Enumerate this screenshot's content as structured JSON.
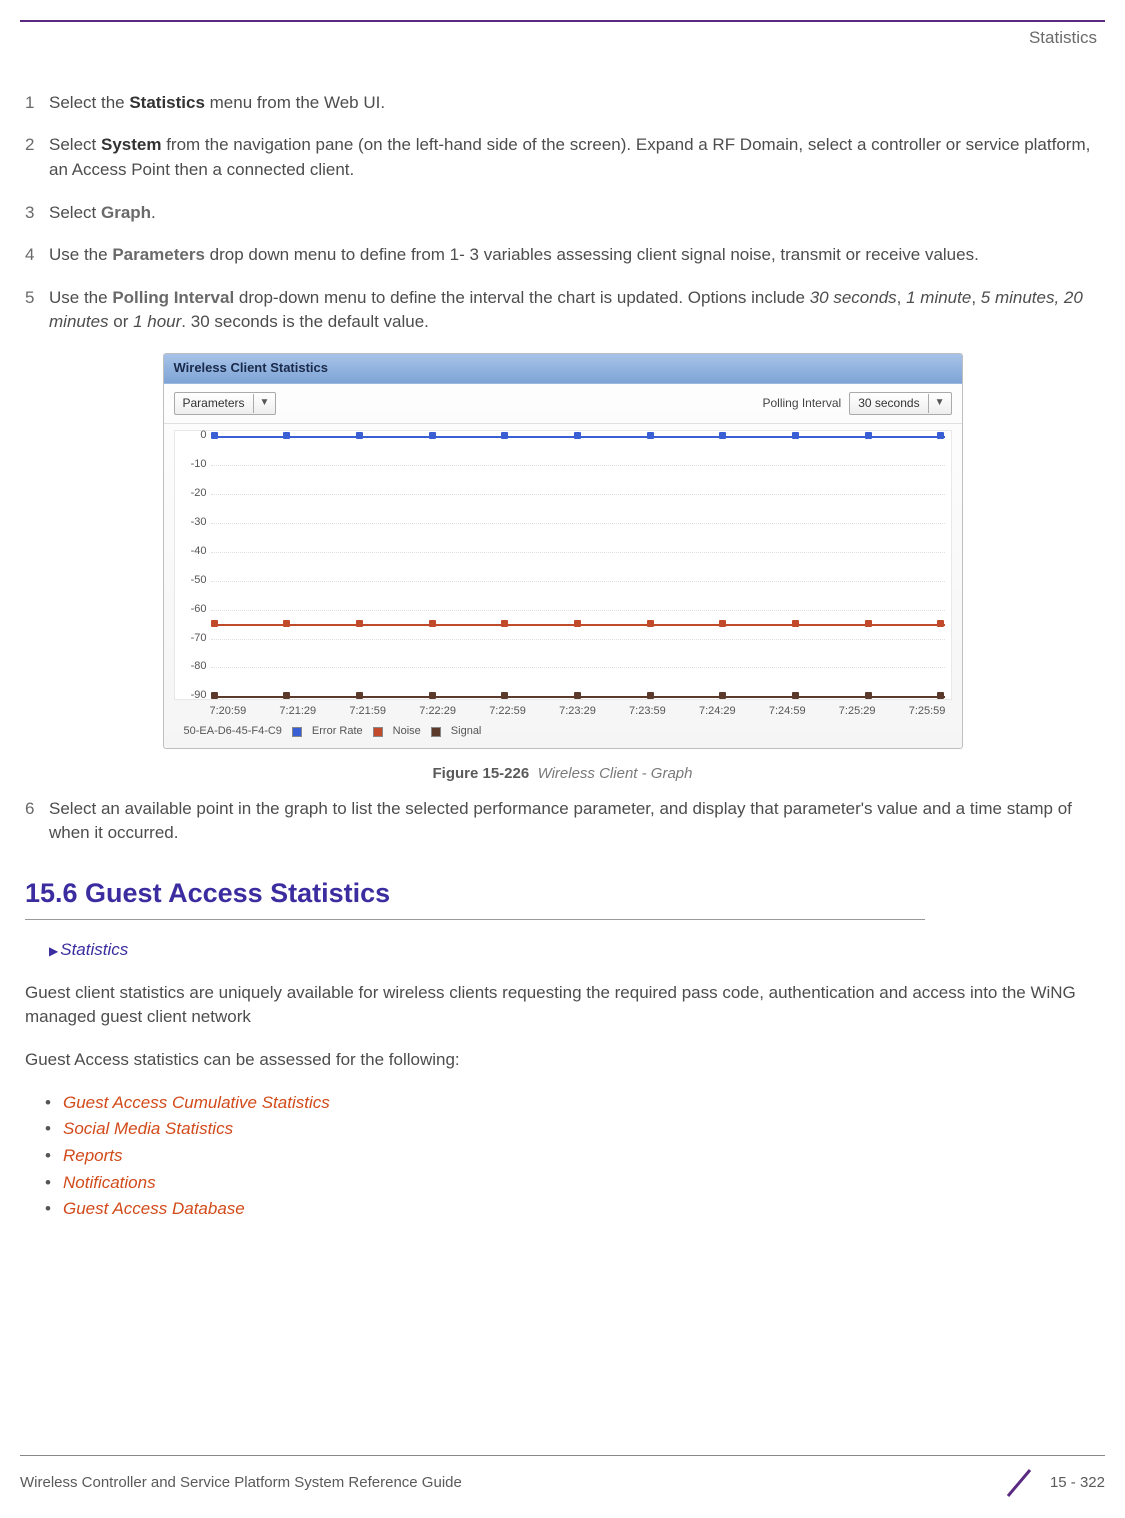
{
  "header_section": "Statistics",
  "steps": [
    {
      "n": "1",
      "pre": "Select the ",
      "bold": "Statistics",
      "post": " menu from the Web UI."
    },
    {
      "n": "2",
      "pre": "Select ",
      "bold": "System",
      "post": " from the navigation pane (on the left-hand side of the screen). Expand a RF Domain, select a controller or service platform, an Access Point then a connected client."
    },
    {
      "n": "3",
      "pre": "Select ",
      "bold": "Graph",
      "post": "."
    },
    {
      "n": "4",
      "pre": "Use the ",
      "bold": "Parameters",
      "post": " drop down menu to define from 1- 3 variables assessing client signal noise, transmit or receive values."
    },
    {
      "n": "5",
      "pre": "Use the ",
      "bold": "Polling Interval",
      "post_html": " drop-down menu to define the interval the chart is updated. Options include <i>30 seconds</i>, <i>1 minute</i>, <i>5 minutes, 20 minutes</i> or <i>1 hour</i>. 30 seconds is the default value."
    }
  ],
  "chart": {
    "panel_title": "Wireless Client Statistics",
    "parameters_label": "Parameters",
    "polling_label": "Polling Interval",
    "polling_value": "30 seconds",
    "device_id": "50-EA-D6-45-F4-C9",
    "legend": {
      "error_rate": "Error Rate",
      "noise": "Noise",
      "signal": "Signal"
    }
  },
  "figure": {
    "label": "Figure 15-226",
    "title": "Wireless Client - Graph"
  },
  "step6": "Select an available point in the graph to list the selected performance parameter, and display that parameter's value and a time stamp of when it occurred.",
  "section": {
    "title": "15.6 Guest Access Statistics",
    "breadcrumb": "Statistics",
    "para1": "Guest client statistics are uniquely available for wireless clients requesting the required pass code, authentication and access into the WiNG managed guest client network",
    "para2": "Guest Access statistics can be assessed for the following:",
    "links": [
      "Guest Access Cumulative Statistics",
      "Social Media Statistics",
      "Reports",
      "Notifications",
      "Guest Access Database"
    ]
  },
  "footer": {
    "left": "Wireless Controller and Service Platform System Reference Guide",
    "right": "15 - 322"
  },
  "chart_data": {
    "type": "line",
    "title": "Wireless Client Statistics",
    "xlabel": "",
    "ylabel": "",
    "ylim": [
      -90,
      0
    ],
    "x": [
      "7:20:59",
      "7:21:29",
      "7:21:59",
      "7:22:29",
      "7:22:59",
      "7:23:29",
      "7:23:59",
      "7:24:29",
      "7:24:59",
      "7:25:29",
      "7:25:59"
    ],
    "series": [
      {
        "name": "Error Rate",
        "values": [
          0,
          0,
          0,
          0,
          0,
          0,
          0,
          0,
          0,
          0,
          0
        ]
      },
      {
        "name": "Noise",
        "values": [
          -65,
          -65,
          -65,
          -65,
          -65,
          -65,
          -65,
          -65,
          -65,
          -65,
          -65
        ]
      },
      {
        "name": "Signal",
        "values": [
          -90,
          -90,
          -90,
          -90,
          -90,
          -90,
          -90,
          -90,
          -90,
          -90,
          -90
        ]
      }
    ],
    "y_ticks": [
      0,
      -10,
      -20,
      -30,
      -40,
      -50,
      -60,
      -70,
      -80,
      -90
    ]
  }
}
